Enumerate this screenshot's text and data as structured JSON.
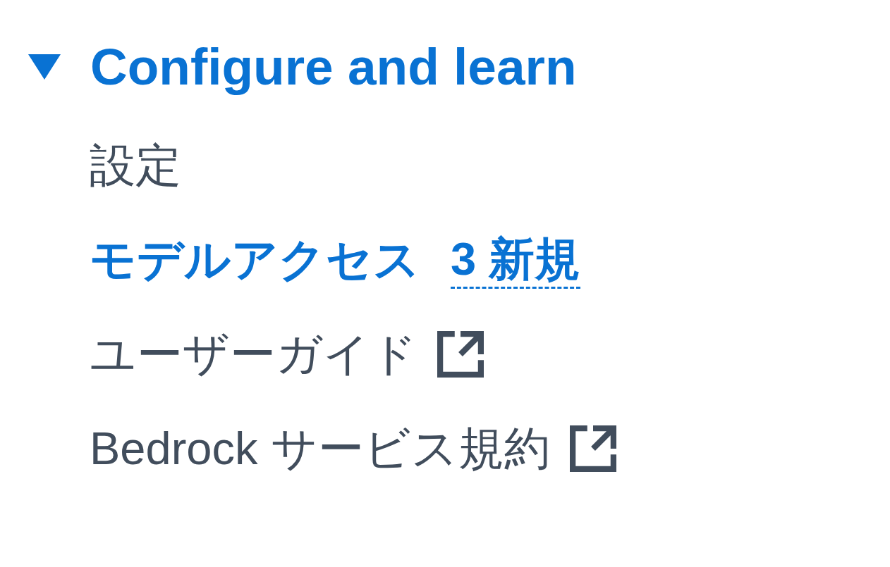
{
  "section": {
    "title": "Configure and learn",
    "expanded": true
  },
  "items": [
    {
      "label": "設定",
      "selected": false,
      "external": false
    },
    {
      "label": "モデルアクセス",
      "selected": true,
      "external": false,
      "badge": "3 新規"
    },
    {
      "label": "ユーザーガイド",
      "selected": false,
      "external": true
    },
    {
      "label": "Bedrock サービス規約",
      "selected": false,
      "external": true
    }
  ]
}
